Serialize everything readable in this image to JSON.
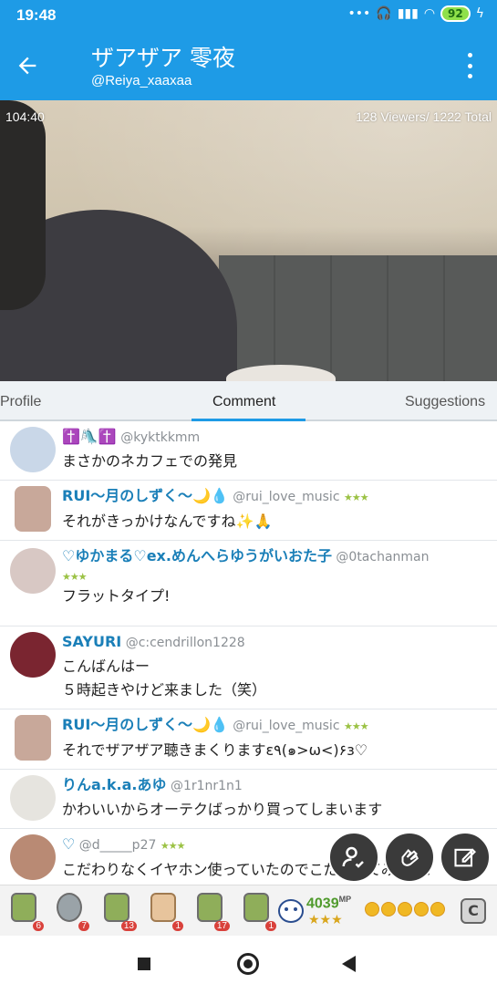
{
  "status_bar": {
    "time": "19:48",
    "battery": "92"
  },
  "header": {
    "title": "ザアザア 零夜",
    "subtitle": "@Reiya_xaaxaa"
  },
  "video": {
    "elapsed": "104:40",
    "viewers": "128 Viewers/ 1222 Total"
  },
  "tabs": [
    {
      "label": "Profile"
    },
    {
      "label": "Comment",
      "active": true
    },
    {
      "label": "Suggestions"
    }
  ],
  "comments": [
    {
      "name": "✝️🛝✝️",
      "handle": "@kyktkkmm",
      "badge": "",
      "text": "まさかのネカフェでの発見",
      "avatar_color": "#c9d7e8"
    },
    {
      "name": "RUI〜月のしずく〜🌙💧",
      "handle": "@rui_love_music",
      "badge": "★★★",
      "text": "それがきっかけなんですね✨🙏",
      "avatar_color": "#c8a89a"
    },
    {
      "name": "♡ゆかまる♡ex.めんへらゆうがいおた子",
      "handle": "@0tachanman",
      "badge": "★★★",
      "text": "フラットタイプ!",
      "avatar_color": "#d8c8c4"
    },
    {
      "name": "SAYURI",
      "handle": "@c:cendrillon1228",
      "badge": "",
      "text": "こんばんはー\n５時起きやけど来ました（笑）",
      "avatar_color": "#7a2530"
    },
    {
      "name": "RUI〜月のしずく〜🌙💧",
      "handle": "@rui_love_music",
      "badge": "★★★",
      "text": "それでザアザア聴きまくりますε٩(๑>ω<)۶з♡",
      "avatar_color": "#c8a89a"
    },
    {
      "name": "りんa.k.a.あゆ",
      "handle": "@1r1nr1n1",
      "badge": "",
      "text": "かわいいからオーテクばっかり買ってしまいます",
      "avatar_color": "#e6e4df"
    },
    {
      "name": "♡",
      "handle": "@d_____p27",
      "badge": "★★★",
      "text": "こだわりなくイヤホン使っていたのでこだわってみます！",
      "avatar_color": "#b98a74"
    }
  ],
  "gifts": [
    {
      "icon": "tea-10-icon",
      "count": "6"
    },
    {
      "icon": "bowl-icon",
      "count": "7"
    },
    {
      "icon": "tea-50-icon",
      "count": "13"
    },
    {
      "icon": "hands-icon",
      "count": "1"
    },
    {
      "icon": "tea-100-icon",
      "count": "17"
    },
    {
      "icon": "tea-icon",
      "count": "1"
    }
  ],
  "mp": {
    "value": "4039",
    "unit": "MP",
    "stars": "★★★"
  },
  "c_button": "C"
}
